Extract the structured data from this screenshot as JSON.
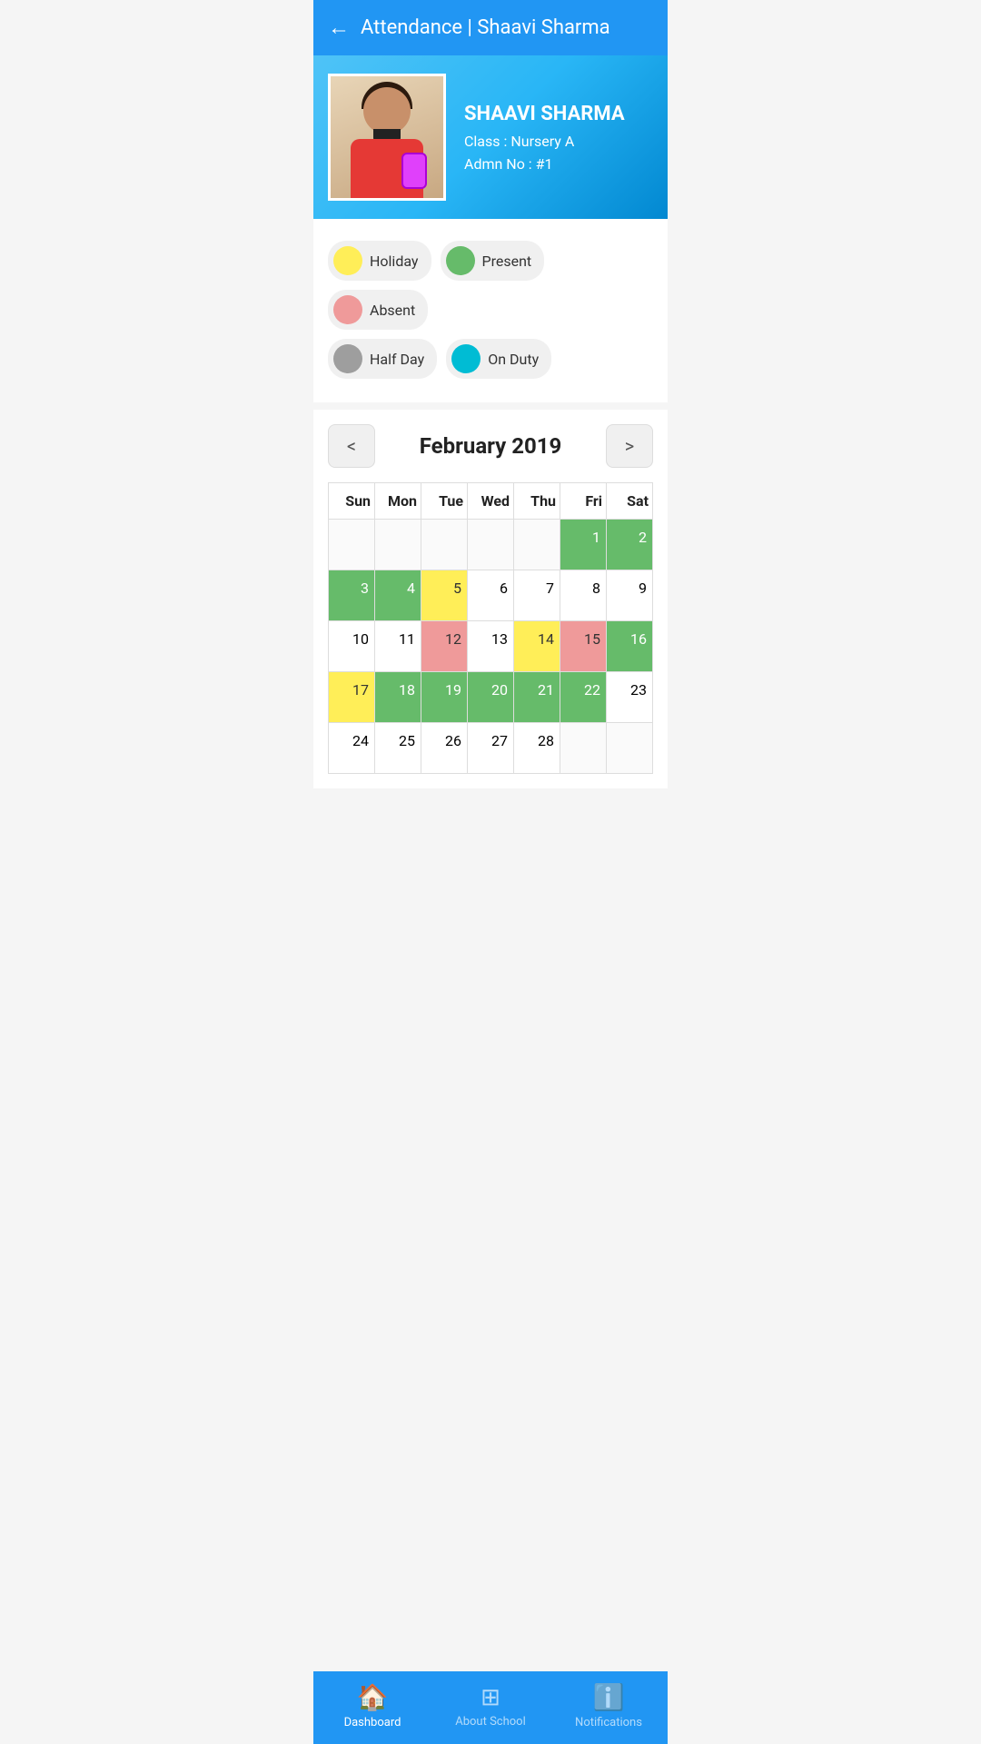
{
  "header": {
    "back_icon": "←",
    "title": "Attendance | Shaavi Sharma"
  },
  "profile": {
    "name": "SHAAVI SHARMA",
    "class_label": "Class : Nursery A",
    "admn_label": "Admn No : #1"
  },
  "legend": {
    "items": [
      {
        "id": "holiday",
        "label": "Holiday",
        "color": "#FFEE58"
      },
      {
        "id": "present",
        "label": "Present",
        "color": "#66BB6A"
      },
      {
        "id": "absent",
        "label": "Absent",
        "color": "#EF9A9A"
      },
      {
        "id": "halfday",
        "label": "Half Day",
        "color": "#9E9E9E"
      },
      {
        "id": "onduty",
        "label": "On Duty",
        "color": "#00BCD4"
      }
    ]
  },
  "calendar": {
    "prev_icon": "<",
    "next_icon": ">",
    "month_title": "February 2019",
    "day_headers": [
      "Sun",
      "Mon",
      "Tue",
      "Wed",
      "Thu",
      "Fri",
      "Sat"
    ],
    "weeks": [
      [
        {
          "day": "",
          "class": "cell-empty"
        },
        {
          "day": "",
          "class": "cell-empty"
        },
        {
          "day": "",
          "class": "cell-empty"
        },
        {
          "day": "",
          "class": "cell-empty"
        },
        {
          "day": "",
          "class": "cell-empty"
        },
        {
          "day": "1",
          "class": "cell-green"
        },
        {
          "day": "2",
          "class": "cell-green"
        }
      ],
      [
        {
          "day": "3",
          "class": "cell-green"
        },
        {
          "day": "4",
          "class": "cell-green"
        },
        {
          "day": "5",
          "class": "cell-yellow"
        },
        {
          "day": "6",
          "class": "cell-white"
        },
        {
          "day": "7",
          "class": "cell-white"
        },
        {
          "day": "8",
          "class": "cell-white"
        },
        {
          "day": "9",
          "class": "cell-white"
        }
      ],
      [
        {
          "day": "10",
          "class": "cell-white"
        },
        {
          "day": "11",
          "class": "cell-white"
        },
        {
          "day": "12",
          "class": "cell-red"
        },
        {
          "day": "13",
          "class": "cell-white"
        },
        {
          "day": "14",
          "class": "cell-yellow"
        },
        {
          "day": "15",
          "class": "cell-red"
        },
        {
          "day": "16",
          "class": "cell-green"
        }
      ],
      [
        {
          "day": "17",
          "class": "cell-yellow"
        },
        {
          "day": "18",
          "class": "cell-green"
        },
        {
          "day": "19",
          "class": "cell-green"
        },
        {
          "day": "20",
          "class": "cell-green"
        },
        {
          "day": "21",
          "class": "cell-green"
        },
        {
          "day": "22",
          "class": "cell-green"
        },
        {
          "day": "23",
          "class": "cell-white"
        }
      ],
      [
        {
          "day": "24",
          "class": "cell-white"
        },
        {
          "day": "25",
          "class": "cell-white"
        },
        {
          "day": "26",
          "class": "cell-white"
        },
        {
          "day": "27",
          "class": "cell-white"
        },
        {
          "day": "28",
          "class": "cell-white"
        },
        {
          "day": "",
          "class": "cell-empty"
        },
        {
          "day": "",
          "class": "cell-empty"
        }
      ]
    ]
  },
  "bottom_nav": {
    "items": [
      {
        "id": "dashboard",
        "label": "Dashboard",
        "icon": "🏠",
        "active": true
      },
      {
        "id": "about-school",
        "label": "About School",
        "icon": "▦",
        "active": false
      },
      {
        "id": "notifications",
        "label": "Notifications",
        "icon": "ℹ",
        "active": false
      }
    ]
  }
}
